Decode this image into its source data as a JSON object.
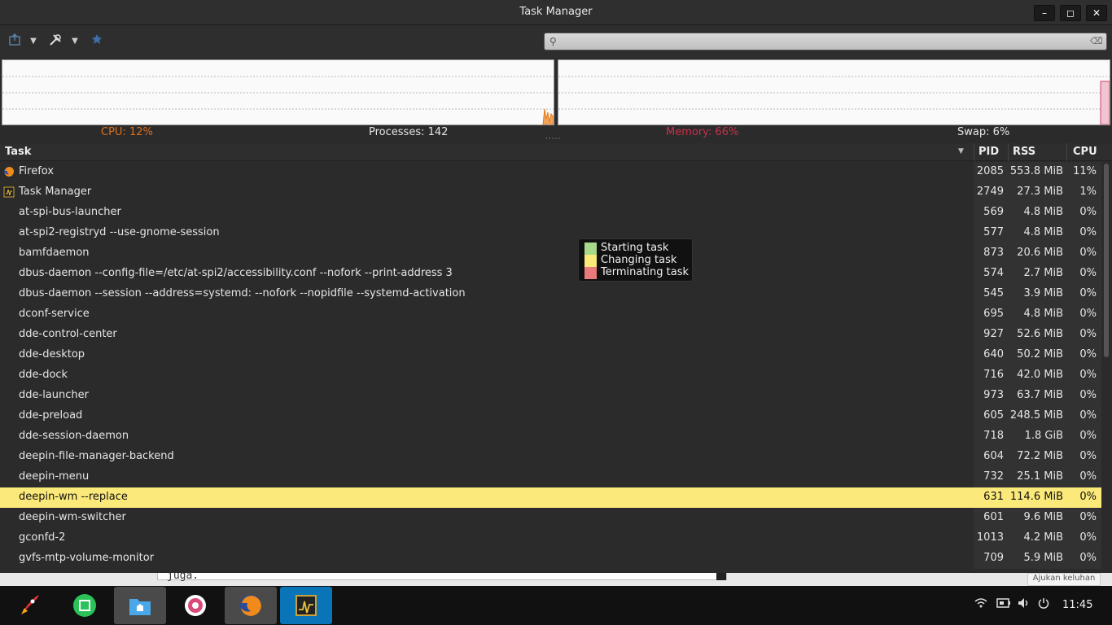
{
  "window": {
    "title": "Task Manager",
    "min": "–",
    "max": "◻",
    "close": "✕"
  },
  "toolbar": {
    "search_placeholder": "",
    "search_value": ""
  },
  "stats": {
    "cpu": "CPU: 12%",
    "processes": "Processes: 142",
    "memory": "Memory: 66%",
    "swap": "Swap: 6%"
  },
  "graphs": {
    "cpu_color": "#e07c1a",
    "mem_color": "#d0406a"
  },
  "columns": {
    "task": "Task",
    "pid": "PID",
    "rss": "RSS",
    "cpu": "CPU"
  },
  "legend": [
    {
      "label": "Starting task",
      "color": "#a8d88a"
    },
    {
      "label": "Changing task",
      "color": "#fbe97a"
    },
    {
      "label": "Terminating task",
      "color": "#e87a7a"
    }
  ],
  "rows": [
    {
      "name": "Firefox",
      "pid": "2085",
      "rss": "553.8 MiB",
      "cpu": "11%",
      "icon": "firefox-icon"
    },
    {
      "name": "Task Manager",
      "pid": "2749",
      "rss": "27.3 MiB",
      "cpu": "1%",
      "icon": "task-manager-icon"
    },
    {
      "name": "at-spi-bus-launcher",
      "pid": "569",
      "rss": "4.8 MiB",
      "cpu": "0%"
    },
    {
      "name": "at-spi2-registryd --use-gnome-session",
      "pid": "577",
      "rss": "4.8 MiB",
      "cpu": "0%"
    },
    {
      "name": "bamfdaemon",
      "pid": "873",
      "rss": "20.6 MiB",
      "cpu": "0%"
    },
    {
      "name": "dbus-daemon --config-file=/etc/at-spi2/accessibility.conf --nofork --print-address 3",
      "pid": "574",
      "rss": "2.7 MiB",
      "cpu": "0%"
    },
    {
      "name": "dbus-daemon --session --address=systemd: --nofork --nopidfile --systemd-activation",
      "pid": "545",
      "rss": "3.9 MiB",
      "cpu": "0%"
    },
    {
      "name": "dconf-service",
      "pid": "695",
      "rss": "4.8 MiB",
      "cpu": "0%"
    },
    {
      "name": "dde-control-center",
      "pid": "927",
      "rss": "52.6 MiB",
      "cpu": "0%"
    },
    {
      "name": "dde-desktop",
      "pid": "640",
      "rss": "50.2 MiB",
      "cpu": "0%"
    },
    {
      "name": "dde-dock",
      "pid": "716",
      "rss": "42.0 MiB",
      "cpu": "0%"
    },
    {
      "name": "dde-launcher",
      "pid": "973",
      "rss": "63.7 MiB",
      "cpu": "0%"
    },
    {
      "name": "dde-preload",
      "pid": "605",
      "rss": "248.5 MiB",
      "cpu": "0%"
    },
    {
      "name": "dde-session-daemon",
      "pid": "718",
      "rss": "1.8 GiB",
      "cpu": "0%"
    },
    {
      "name": "deepin-file-manager-backend",
      "pid": "604",
      "rss": "72.2 MiB",
      "cpu": "0%"
    },
    {
      "name": "deepin-menu",
      "pid": "732",
      "rss": "25.1 MiB",
      "cpu": "0%"
    },
    {
      "name": "deepin-wm --replace",
      "pid": "631",
      "rss": "114.6 MiB",
      "cpu": "0%",
      "highlight": true
    },
    {
      "name": "deepin-wm-switcher",
      "pid": "601",
      "rss": "9.6 MiB",
      "cpu": "0%"
    },
    {
      "name": "gconfd-2",
      "pid": "1013",
      "rss": "4.2 MiB",
      "cpu": "0%"
    },
    {
      "name": "gvfs-mtp-volume-monitor",
      "pid": "709",
      "rss": "5.9 MiB",
      "cpu": "0%"
    }
  ],
  "background_window": {
    "text": "juga.",
    "button": "Ajukan keluhan"
  },
  "taskbar": {
    "apps": [
      "launcher-rocket-icon",
      "store-icon",
      "file-manager-icon",
      "settings-icon",
      "firefox-icon",
      "task-manager-icon"
    ],
    "clock": "11:45"
  }
}
